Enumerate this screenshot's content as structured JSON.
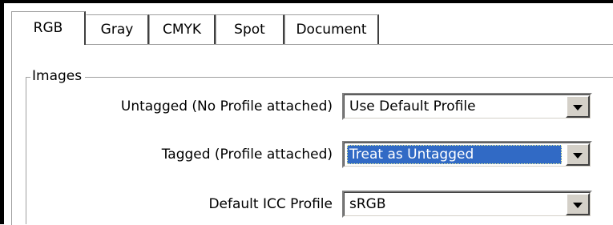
{
  "tabs": [
    {
      "label": "RGB",
      "active": true
    },
    {
      "label": "Gray",
      "active": false
    },
    {
      "label": "CMYK",
      "active": false
    },
    {
      "label": "Spot",
      "active": false
    },
    {
      "label": "Document",
      "active": false
    }
  ],
  "images_group": {
    "legend": "Images",
    "rows": [
      {
        "label": "Untagged (No Profile attached)",
        "value": "Use Default Profile",
        "highlighted": false
      },
      {
        "label": "Tagged (Profile attached)",
        "value": "Treat as Untagged",
        "highlighted": true
      },
      {
        "label": "Default ICC Profile",
        "value": "sRGB",
        "highlighted": false
      }
    ]
  },
  "colors": {
    "selection": "#316ac5",
    "face": "#d4d0c8"
  }
}
